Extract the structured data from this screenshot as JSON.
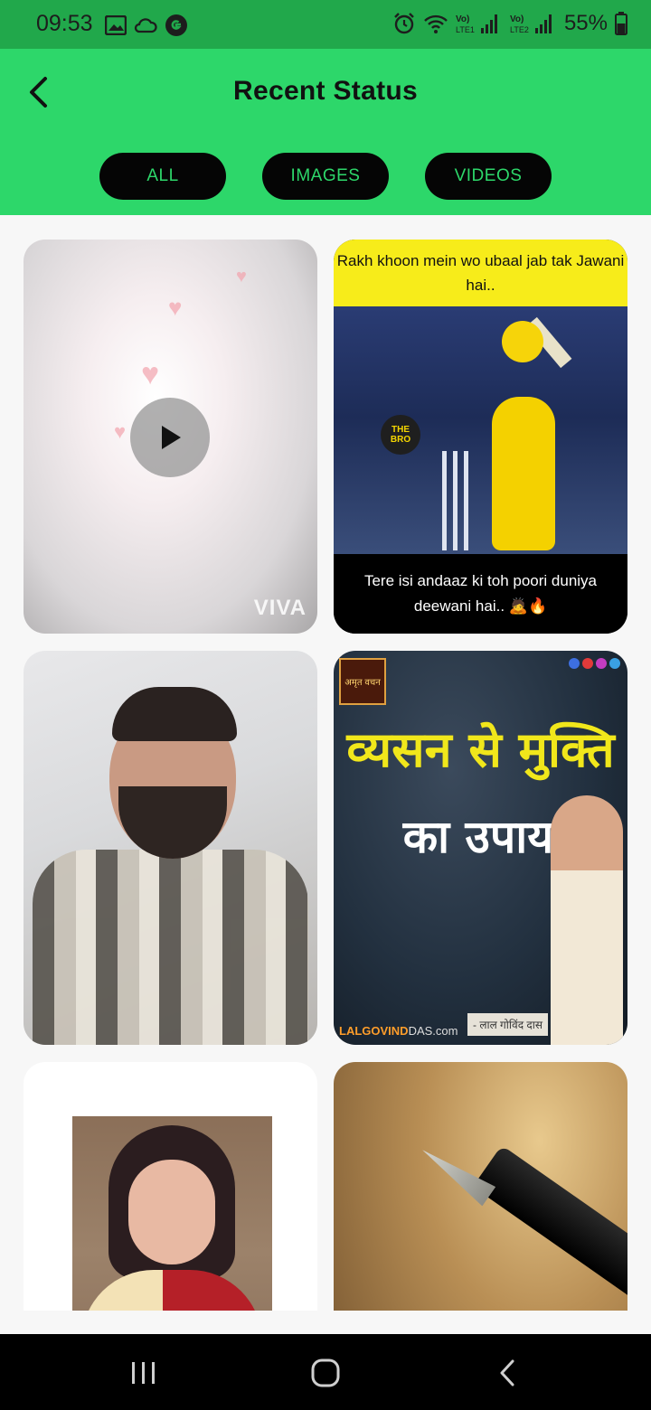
{
  "status_bar": {
    "time": "09:53",
    "battery": "55%",
    "left_icons": [
      "gallery-icon",
      "cloud-icon",
      "g-icon"
    ],
    "right_icons": [
      "alarm-icon",
      "wifi-icon",
      "volte-lte1-signal-icon",
      "volte-lte2-signal-icon",
      "battery-icon"
    ],
    "signal_labels": [
      "Vo) LTE1",
      "Vo) LTE2"
    ]
  },
  "header": {
    "title": "Recent Status",
    "back_icon": "back-arrow-icon",
    "accent": "#2dd76a"
  },
  "tabs": [
    {
      "label": "ALL"
    },
    {
      "label": "IMAGES"
    },
    {
      "label": "VIDEOS"
    }
  ],
  "cards": [
    {
      "type": "video",
      "watermark": "VIVA"
    },
    {
      "type": "image",
      "top_text": "Rakh khoon mein wo ubaal jab tak Jawani hai..",
      "bottom_text": "Tere isi andaaz ki toh poori duniya deewani hai.. 🙇🔥",
      "logo_text": "THE BRO"
    },
    {
      "type": "image"
    },
    {
      "type": "image",
      "line1": "व्यसन से मुक्ति",
      "line2": "का उपाय",
      "logo_text": "अमृत वचन",
      "site": "LALGOVINDDAS.com",
      "site_prefix": "LALGOVIND",
      "site_suffix": "DAS.com",
      "author": "- लाल गोविंद दास"
    },
    {
      "type": "image"
    },
    {
      "type": "image"
    }
  ],
  "nav": {
    "recents_icon": "recents-icon",
    "home_icon": "home-icon",
    "back_icon": "back-icon"
  }
}
